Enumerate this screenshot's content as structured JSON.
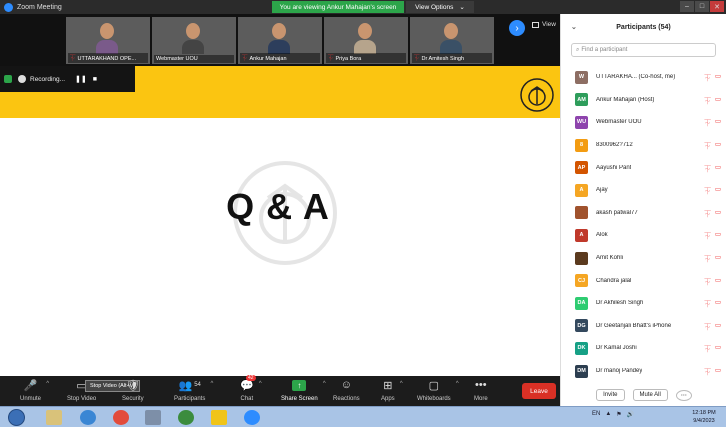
{
  "window": {
    "title": "Zoom Meeting",
    "share_banner": "You are viewing Ankur Mahajan's screen",
    "view_options": "View Options",
    "view_options_caret": "⌄",
    "controls": [
      "–",
      "□",
      "✕"
    ]
  },
  "video_strip": {
    "tiles": [
      {
        "name": "UTTARAKHAND OPE..."
      },
      {
        "name": "Webmaster UOU"
      },
      {
        "name": "Ankur Mahajan"
      },
      {
        "name": "Priya Bora"
      },
      {
        "name": "Dr Amitesh Singh"
      }
    ],
    "next_icon": "›",
    "view_label": "View"
  },
  "recording": {
    "label": "Recording...",
    "pause": "❚❚",
    "stop": "■"
  },
  "shared_content": {
    "heading": "Q & A"
  },
  "toolbar": {
    "items": [
      {
        "label": "Unmute",
        "icon": "🎤"
      },
      {
        "label": "Stop Video",
        "icon": "▭"
      },
      {
        "label": "Security",
        "icon": "🛡"
      },
      {
        "label": "Participants",
        "icon": "👥",
        "count": "54"
      },
      {
        "label": "Chat",
        "icon": "💬",
        "badge": "42"
      },
      {
        "label": "Share Screen",
        "icon": "↑"
      },
      {
        "label": "Reactions",
        "icon": "☺"
      },
      {
        "label": "Apps",
        "icon": "⊞"
      },
      {
        "label": "Whiteboards",
        "icon": "▢"
      },
      {
        "label": "More",
        "icon": "•••"
      }
    ],
    "caret": "^",
    "tooltip": "Stop Video (Alt+V)",
    "leave": "Leave"
  },
  "participants_panel": {
    "title": "Participants (54)",
    "collapse_icon": "⌄",
    "search_placeholder": "Find a participant",
    "participants": [
      {
        "initials": "W",
        "color": "#8d6e63",
        "name": "UTTARAKHA... (Co-host, me)"
      },
      {
        "initials": "AM",
        "color": "#2e9d5b",
        "name": "Ankur Mahajan (Host)"
      },
      {
        "initials": "WU",
        "color": "#8e44ad",
        "name": "Webmaster UOU"
      },
      {
        "initials": "8",
        "color": "#f39c12",
        "name": "8300962?712"
      },
      {
        "initials": "AP",
        "color": "#d35400",
        "name": "Aayushi Pant"
      },
      {
        "initials": "A",
        "color": "#f5a623",
        "name": "Ajay"
      },
      {
        "initials": "",
        "color": "#a0522d",
        "name": "akash patwal77"
      },
      {
        "initials": "A",
        "color": "#c0392b",
        "name": "Alok"
      },
      {
        "initials": "",
        "color": "#5b3a1e",
        "name": "Amit Kohli"
      },
      {
        "initials": "CJ",
        "color": "#f5a623",
        "name": "Chandra jalal"
      },
      {
        "initials": "DA",
        "color": "#2ecc71",
        "name": "Dr Akhilesh Singh"
      },
      {
        "initials": "DG",
        "color": "#34495e",
        "name": "Dr Geetanjali Bhatt's iPhone"
      },
      {
        "initials": "DK",
        "color": "#16a085",
        "name": "Dr Kamal Joshi"
      },
      {
        "initials": "DM",
        "color": "#2c3e50",
        "name": "Dr manoj Pandey"
      }
    ],
    "invite": "Invite",
    "mute_all": "Mute All",
    "more": "⋯"
  },
  "taskbar": {
    "tray": [
      "EN",
      "▲",
      "⚑",
      "🔊"
    ],
    "time": "12:18 PM",
    "date": "9/4/2023"
  }
}
